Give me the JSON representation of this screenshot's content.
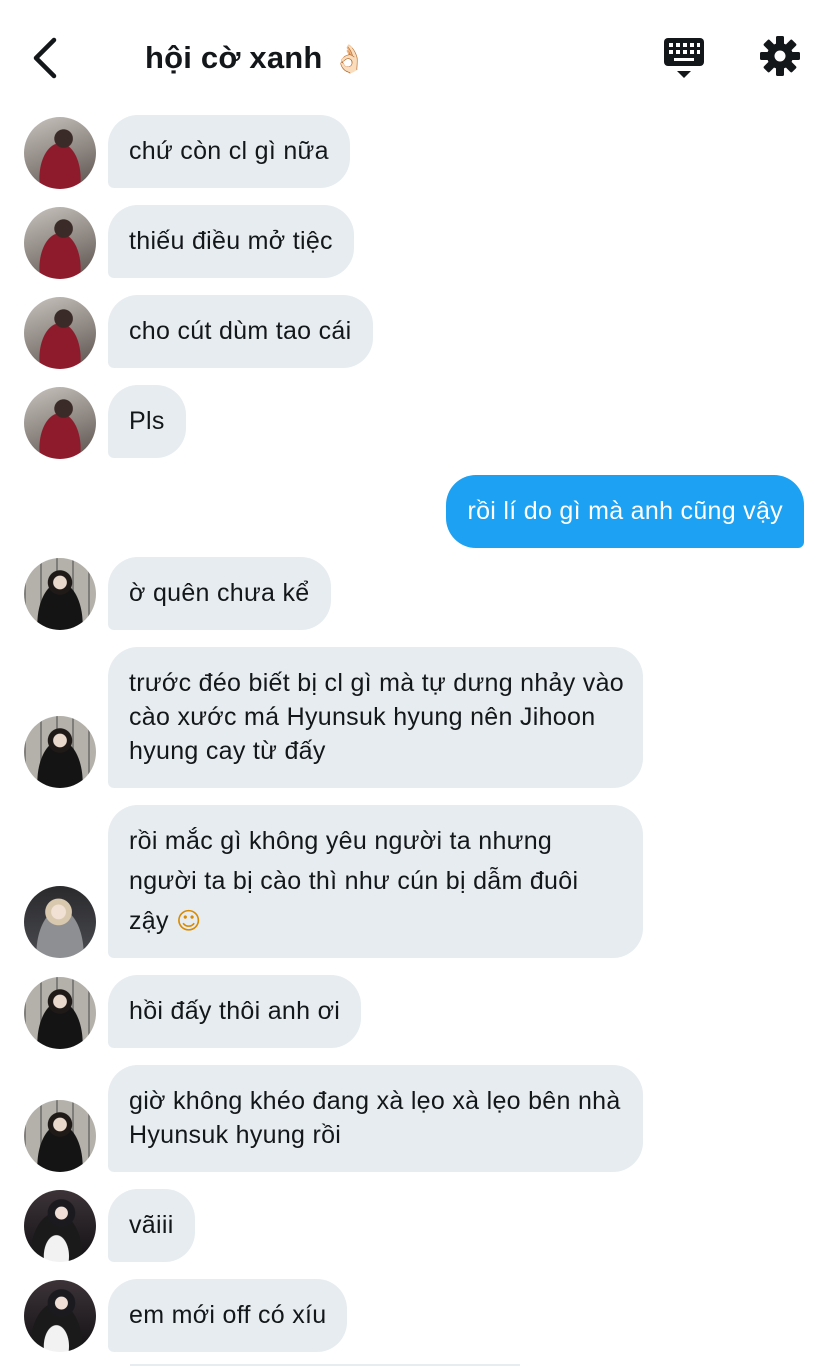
{
  "header": {
    "title": "hội cờ xanh",
    "title_emoji": "👌🏻",
    "back_icon": "chevron-left-icon",
    "keyboard_icon": "keyboard-icon",
    "settings_icon": "gear-icon"
  },
  "colors": {
    "incoming_bubble": "#e6ecf0",
    "outgoing_bubble": "#1da1f2",
    "text": "#14171a"
  },
  "messages": [
    {
      "sender": "user-a",
      "text": "chứ còn cl gì nữa"
    },
    {
      "sender": "user-a",
      "text": "thiếu điều mở tiệc"
    },
    {
      "sender": "user-a",
      "text": "cho cút dùm tao cái"
    },
    {
      "sender": "user-a",
      "text": "Pls"
    },
    {
      "sender": "me",
      "text": "rồi lí do gì mà anh cũng vậy"
    },
    {
      "sender": "user-b",
      "text": "ờ quên chưa kể"
    },
    {
      "sender": "user-b",
      "text": "trước đéo biết bị cl gì mà tự dưng nhảy vào cào xước má Hyunsuk hyung nên Jihoon hyung cay từ đấy"
    },
    {
      "sender": "user-c",
      "text": "rồi mắc gì không yêu người ta nhưng người ta bị cào thì như cún bị dẫm đuôi zậy",
      "emoji": "☺"
    },
    {
      "sender": "user-b",
      "text": "hồi đấy thôi anh ơi"
    },
    {
      "sender": "user-b",
      "text": "giờ không khéo đang xà lẹo xà lẹo bên nhà Hyunsuk hyung rồi"
    },
    {
      "sender": "user-d",
      "text": "vãiii"
    },
    {
      "sender": "user-d",
      "text": "em mới off có xíu"
    }
  ]
}
